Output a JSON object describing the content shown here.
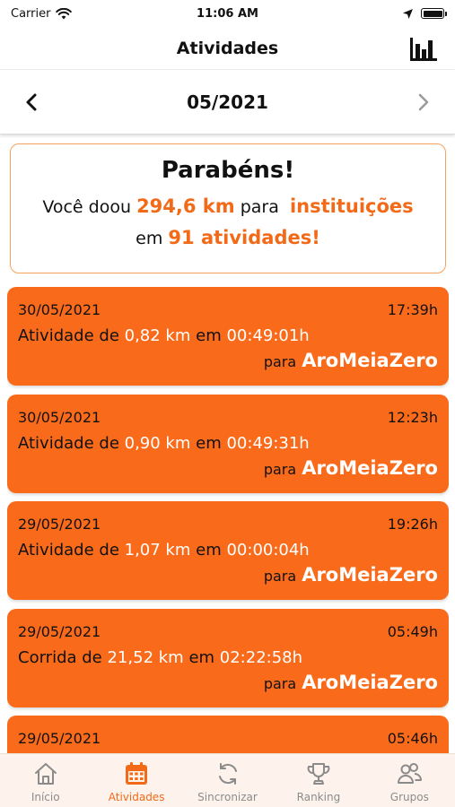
{
  "status_bar": {
    "carrier": "Carrier",
    "time": "11:06 AM",
    "icons": [
      "wifi-icon",
      "location-arrow-icon",
      "battery-icon"
    ]
  },
  "nav": {
    "title": "Atividades",
    "right_icon": "bar-chart-icon"
  },
  "month_selector": {
    "label": "05/2021",
    "prev_icon": "chevron-left-icon",
    "next_icon": "chevron-right-icon"
  },
  "congrats": {
    "title": "Parabéns!",
    "text1": "Você doou",
    "distance": "294,6 km",
    "text2": "para",
    "target": "instituições",
    "text3": "em",
    "activities": "91 atividades!"
  },
  "activities": [
    {
      "date": "30/05/2021",
      "time": "17:39h",
      "type": "Atividade de",
      "distance": "0,82 km",
      "sep": "em",
      "duration": "00:49:01h",
      "for": "para",
      "institution": "AroMeiaZero"
    },
    {
      "date": "30/05/2021",
      "time": "12:23h",
      "type": "Atividade de",
      "distance": "0,90 km",
      "sep": "em",
      "duration": "00:49:31h",
      "for": "para",
      "institution": "AroMeiaZero"
    },
    {
      "date": "29/05/2021",
      "time": "19:26h",
      "type": "Atividade de",
      "distance": "1,07 km",
      "sep": "em",
      "duration": "00:00:04h",
      "for": "para",
      "institution": "AroMeiaZero"
    },
    {
      "date": "29/05/2021",
      "time": "05:49h",
      "type": "Corrida de",
      "distance": "21,52 km",
      "sep": "em",
      "duration": "02:22:58h",
      "for": "para",
      "institution": "AroMeiaZero"
    },
    {
      "date": "29/05/2021",
      "time": "05:46h"
    }
  ],
  "tabs": [
    {
      "label": "Início",
      "icon": "home-icon",
      "active": false
    },
    {
      "label": "Atividades",
      "icon": "calendar-icon",
      "active": true
    },
    {
      "label": "Sincronizar",
      "icon": "sync-icon",
      "active": false
    },
    {
      "label": "Ranking",
      "icon": "trophy-icon",
      "active": false
    },
    {
      "label": "Grupos",
      "icon": "group-icon",
      "active": false
    }
  ],
  "colors": {
    "accent": "#f26a17",
    "card_background": "#f96b1a",
    "tab_bar_background": "#fdf3ec"
  }
}
